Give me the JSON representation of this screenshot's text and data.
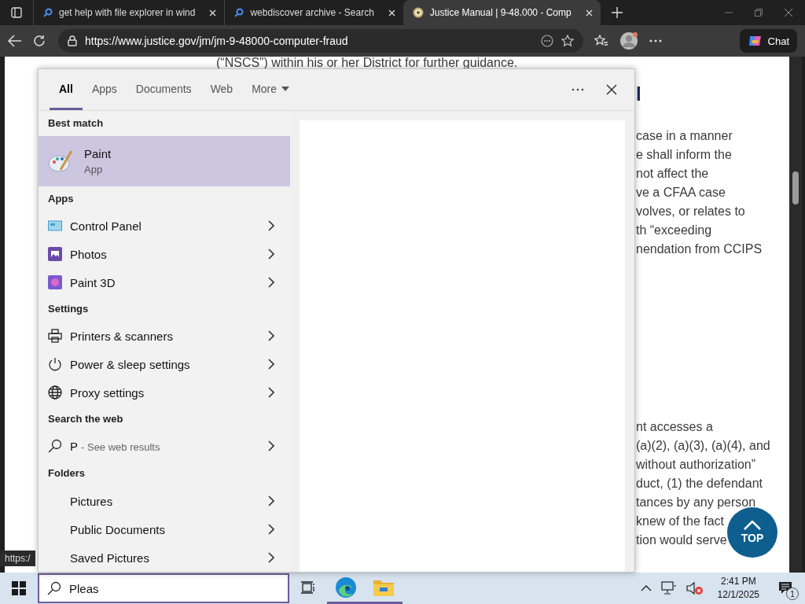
{
  "browser": {
    "tabs": [
      {
        "title": "get help with file explorer in wind",
        "kind": "search",
        "selected": false
      },
      {
        "title": "webdiscover archive - Search",
        "kind": "search",
        "selected": false
      },
      {
        "title": "Justice Manual | 9-48.000 - Comp",
        "kind": "site",
        "selected": true
      }
    ],
    "address": "https://www.justice.gov/jm/jm-9-48000-computer-fraud",
    "chat_button": "Chat"
  },
  "page": {
    "intro_line": "(“NSCS”) within his or her District for further guidance.",
    "heading_fragment": "l",
    "paragraph_1": [
      "case in a manner",
      "e shall inform the",
      "not affect the",
      "ve a CFAA case",
      "volves, or relates to",
      "th “exceeding",
      "nendation from CCIPS"
    ],
    "paragraph_2": [
      "nt accesses a",
      "(a)(2), (a)(3), (a)(4), and",
      "without authorization”",
      "duct, (1) the defendant",
      "tances by any person",
      "knew of the fact",
      "tion would serve"
    ],
    "top_button": "TOP",
    "status_url": "https:/"
  },
  "search_panel": {
    "tabs": [
      {
        "label": "All",
        "kind": "tab",
        "selected": true
      },
      {
        "label": "Apps",
        "kind": "tab",
        "selected": false
      },
      {
        "label": "Documents",
        "kind": "tab",
        "selected": false
      },
      {
        "label": "Web",
        "kind": "tab",
        "selected": false
      },
      {
        "label": "More",
        "kind": "menu",
        "selected": false
      }
    ],
    "best_match": {
      "header": "Best match",
      "name": "Paint",
      "type": "App"
    },
    "sections": [
      {
        "header": "Apps",
        "items": [
          {
            "label": "Control Panel",
            "kind": "control-panel"
          },
          {
            "label": "Photos",
            "kind": "photos"
          },
          {
            "label": "Paint 3D",
            "kind": "paint3d"
          }
        ]
      },
      {
        "header": "Settings",
        "items": [
          {
            "label": "Printers & scanners",
            "kind": "printer"
          },
          {
            "label": "Power & sleep settings",
            "kind": "power"
          },
          {
            "label": "Proxy settings",
            "kind": "globe"
          }
        ]
      },
      {
        "header": "Search the web",
        "items": [
          {
            "label": "P",
            "hint": "- See web results",
            "kind": "web"
          }
        ]
      },
      {
        "header": "Folders",
        "items": [
          {
            "label": "Pictures",
            "kind": "folder"
          },
          {
            "label": "Public Documents",
            "kind": "folder"
          },
          {
            "label": "Saved Pictures",
            "kind": "folder"
          }
        ]
      }
    ],
    "search_box": {
      "value": "Pleas"
    }
  },
  "taskbar": {
    "apps": [
      {
        "kind": "edge",
        "running": true
      },
      {
        "kind": "explorer",
        "running": true
      }
    ],
    "clock": {
      "time": "2:41 PM",
      "date": "12/1/2025"
    },
    "notification_count": "1"
  }
}
